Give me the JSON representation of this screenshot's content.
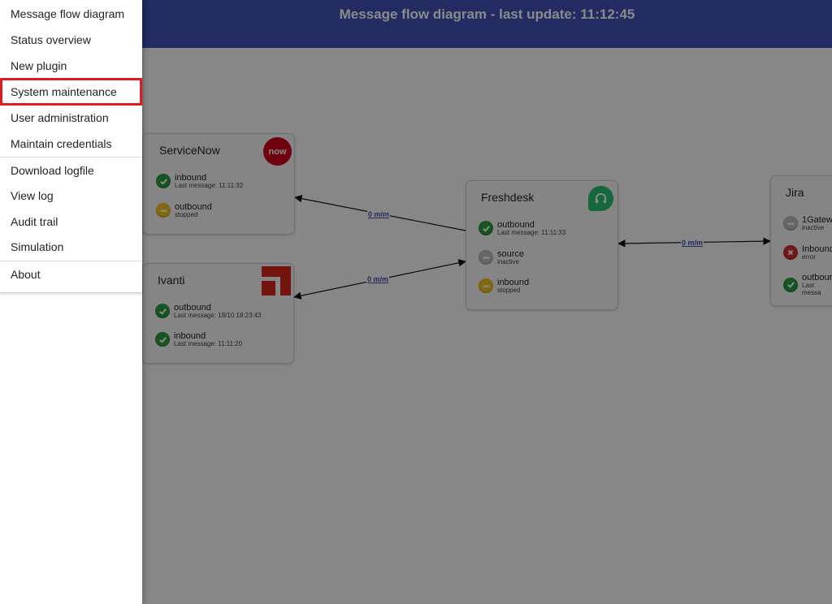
{
  "header": {
    "title": "Message flow diagram - last update: 11:12:45"
  },
  "menu": {
    "items": [
      {
        "label": "Message flow diagram"
      },
      {
        "label": "Status overview"
      },
      {
        "label": "New plugin"
      },
      {
        "label": "System maintenance"
      },
      {
        "label": "User administration"
      },
      {
        "label": "Maintain credentials"
      },
      {
        "label": "Download logfile"
      },
      {
        "label": "View log"
      },
      {
        "label": "Audit trail"
      },
      {
        "label": "Simulation"
      },
      {
        "label": "About"
      }
    ]
  },
  "edges": {
    "servicenow_freshdesk": "0 m/m",
    "ivanti_freshdesk": "0 m/m",
    "freshdesk_jira": "0 m/m"
  },
  "nodes": {
    "servicenow": {
      "title": "ServiceNow",
      "logo_text": "now",
      "brand_color": "#d0021b",
      "rows": [
        {
          "name": "inbound",
          "sub": "Last message: 11:11:32",
          "status": "ok"
        },
        {
          "name": "outbound",
          "sub": "stopped",
          "status": "stopped"
        }
      ]
    },
    "ivanti": {
      "title": "Ivanti",
      "brand_color": "#d9251d",
      "rows": [
        {
          "name": "outbound",
          "sub": "Last message: 18/10 18:23:43",
          "status": "ok"
        },
        {
          "name": "inbound",
          "sub": "Last message: 11:11:20",
          "status": "ok"
        }
      ]
    },
    "freshdesk": {
      "title": "Freshdesk",
      "brand_color": "#25c16f",
      "rows": [
        {
          "name": "outbound",
          "sub": "Last message: 11:11:33",
          "status": "ok"
        },
        {
          "name": "source",
          "sub": "inactive",
          "status": "inactive"
        },
        {
          "name": "inbound",
          "sub": "stopped",
          "status": "stopped"
        }
      ]
    },
    "jira": {
      "title": "Jira",
      "rows": [
        {
          "name": "1Gatew",
          "sub": "inactive",
          "status": "inactive"
        },
        {
          "name": "Inbound",
          "sub": "error",
          "status": "error"
        },
        {
          "name": "outbour",
          "sub": "Last messa",
          "status": "ok"
        }
      ]
    }
  },
  "colors": {
    "header": "#3f51b5",
    "ok": "#2e9b3f",
    "stopped": "#f3c31c",
    "inactive": "#bdbdbd",
    "error": "#d32f2f",
    "highlight": "#e01a22"
  }
}
